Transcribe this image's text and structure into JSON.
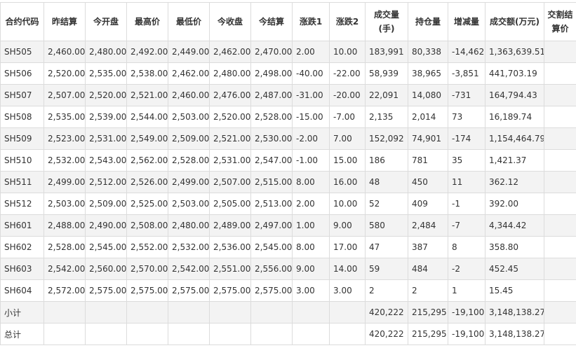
{
  "headers": [
    "合约代码",
    "昨结算",
    "今开盘",
    "最高价",
    "最低价",
    "今收盘",
    "今结算",
    "涨跌1",
    "涨跌2",
    "成交量(手)",
    "持仓量",
    "增减量",
    "成交额(万元)",
    "交割结算价"
  ],
  "rows": [
    [
      "SH505",
      "2,460.00",
      "2,480.00",
      "2,492.00",
      "2,449.00",
      "2,462.00",
      "2,470.00",
      "2.00",
      "10.00",
      "183,991",
      "80,338",
      "-14,462",
      "1,363,639.51",
      ""
    ],
    [
      "SH506",
      "2,520.00",
      "2,535.00",
      "2,538.00",
      "2,462.00",
      "2,480.00",
      "2,498.00",
      "-40.00",
      "-22.00",
      "58,939",
      "38,965",
      "-3,851",
      "441,703.19",
      ""
    ],
    [
      "SH507",
      "2,507.00",
      "2,520.00",
      "2,521.00",
      "2,460.00",
      "2,476.00",
      "2,487.00",
      "-31.00",
      "-20.00",
      "22,091",
      "14,080",
      "-731",
      "164,794.43",
      ""
    ],
    [
      "SH508",
      "2,535.00",
      "2,539.00",
      "2,544.00",
      "2,503.00",
      "2,520.00",
      "2,528.00",
      "-15.00",
      "-7.00",
      "2,135",
      "2,014",
      "73",
      "16,189.74",
      ""
    ],
    [
      "SH509",
      "2,523.00",
      "2,531.00",
      "2,549.00",
      "2,509.00",
      "2,521.00",
      "2,530.00",
      "-2.00",
      "7.00",
      "152,092",
      "74,901",
      "-174",
      "1,154,464.79",
      ""
    ],
    [
      "SH510",
      "2,532.00",
      "2,543.00",
      "2,562.00",
      "2,528.00",
      "2,531.00",
      "2,547.00",
      "-1.00",
      "15.00",
      "186",
      "781",
      "35",
      "1,421.37",
      ""
    ],
    [
      "SH511",
      "2,499.00",
      "2,512.00",
      "2,526.00",
      "2,499.00",
      "2,507.00",
      "2,515.00",
      "8.00",
      "16.00",
      "48",
      "450",
      "11",
      "362.12",
      ""
    ],
    [
      "SH512",
      "2,503.00",
      "2,509.00",
      "2,525.00",
      "2,503.00",
      "2,505.00",
      "2,513.00",
      "2.00",
      "10.00",
      "52",
      "409",
      "-1",
      "392.00",
      ""
    ],
    [
      "SH601",
      "2,488.00",
      "2,490.00",
      "2,508.00",
      "2,480.00",
      "2,489.00",
      "2,497.00",
      "1.00",
      "9.00",
      "580",
      "2,484",
      "-7",
      "4,344.42",
      ""
    ],
    [
      "SH602",
      "2,528.00",
      "2,545.00",
      "2,552.00",
      "2,532.00",
      "2,536.00",
      "2,545.00",
      "8.00",
      "17.00",
      "47",
      "387",
      "8",
      "358.80",
      ""
    ],
    [
      "SH603",
      "2,542.00",
      "2,560.00",
      "2,570.00",
      "2,542.00",
      "2,551.00",
      "2,556.00",
      "9.00",
      "14.00",
      "59",
      "484",
      "-2",
      "452.45",
      ""
    ],
    [
      "SH604",
      "2,572.00",
      "2,575.00",
      "2,575.00",
      "2,575.00",
      "2,575.00",
      "2,575.00",
      "3.00",
      "3.00",
      "2",
      "2",
      "1",
      "15.45",
      ""
    ],
    [
      "小计",
      "",
      "",
      "",
      "",
      "",
      "",
      "",
      "",
      "420,222",
      "215,295",
      "-19,100",
      "3,148,138.27",
      ""
    ],
    [
      "总计",
      "",
      "",
      "",
      "",
      "",
      "",
      "",
      "",
      "420,222",
      "215,295",
      "-19,100",
      "3,148,138.27",
      ""
    ]
  ]
}
